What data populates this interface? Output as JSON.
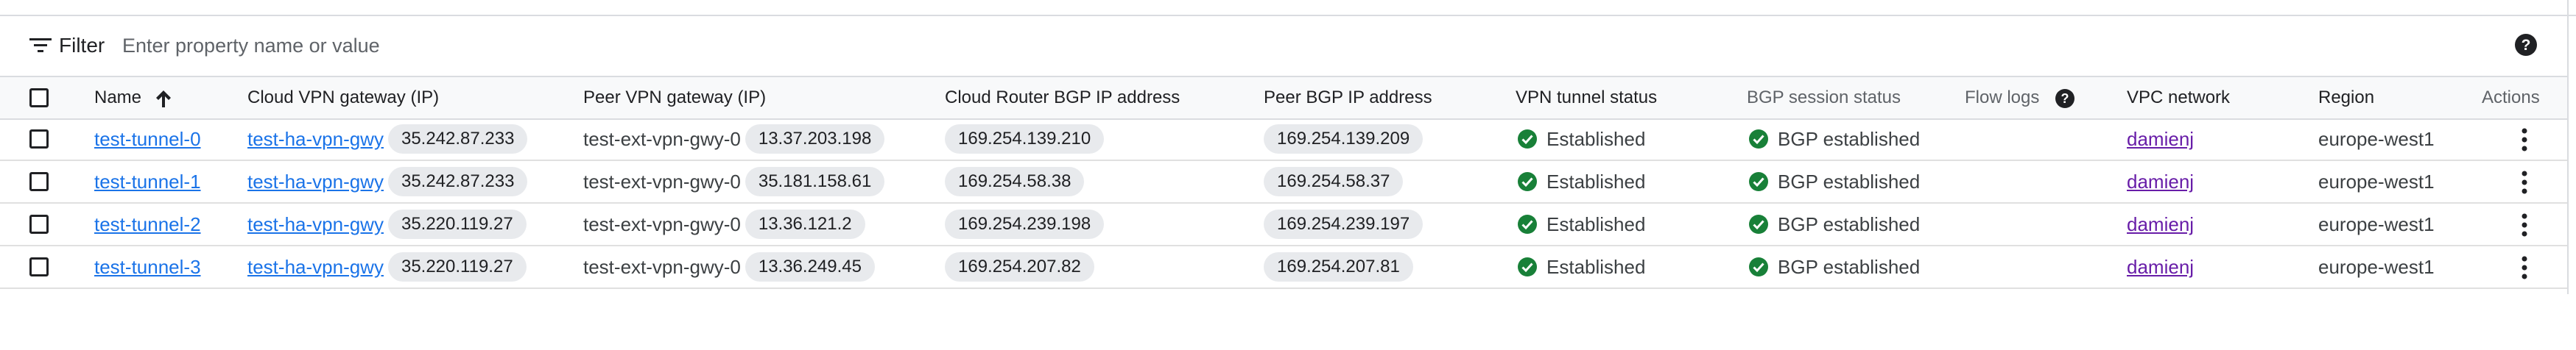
{
  "filter": {
    "label": "Filter",
    "placeholder": "Enter property name or value"
  },
  "columns": {
    "name": "Name",
    "cloud_vpn_gateway": "Cloud VPN gateway (IP)",
    "peer_vpn_gateway": "Peer VPN gateway (IP)",
    "cloud_router_bgp_ip": "Cloud Router BGP IP address",
    "peer_bgp_ip": "Peer BGP IP address",
    "vpn_tunnel_status": "VPN tunnel status",
    "bgp_session_status": "BGP session status",
    "flow_logs": "Flow logs",
    "vpc_network": "VPC network",
    "region": "Region",
    "actions": "Actions"
  },
  "sort": {
    "column": "Name",
    "direction": "ascending"
  },
  "icons": {
    "filter": "filter-icon",
    "help": "help-icon",
    "sort": "arrow-up-icon",
    "status": "check-circle-icon",
    "actions": "more-vert-icon"
  },
  "colors": {
    "link": "#1a73e8",
    "visited_link": "#681da8",
    "status_ok": "#188038",
    "chip_bg": "#e8eaed",
    "header_bg": "#f8f9fa"
  },
  "rows": [
    {
      "name": "test-tunnel-0",
      "cloud_gateway": "test-ha-vpn-gwy",
      "cloud_gateway_ip": "35.242.87.233",
      "peer_gateway": "test-ext-vpn-gwy-0",
      "peer_gateway_ip": "13.37.203.198",
      "cloud_router_bgp_ip": "169.254.139.210",
      "peer_bgp_ip": "169.254.139.209",
      "tunnel_status": "Established",
      "bgp_status": "BGP established",
      "vpc_network": "damienj",
      "region": "europe-west1"
    },
    {
      "name": "test-tunnel-1",
      "cloud_gateway": "test-ha-vpn-gwy",
      "cloud_gateway_ip": "35.242.87.233",
      "peer_gateway": "test-ext-vpn-gwy-0",
      "peer_gateway_ip": "35.181.158.61",
      "cloud_router_bgp_ip": "169.254.58.38",
      "peer_bgp_ip": "169.254.58.37",
      "tunnel_status": "Established",
      "bgp_status": "BGP established",
      "vpc_network": "damienj",
      "region": "europe-west1"
    },
    {
      "name": "test-tunnel-2",
      "cloud_gateway": "test-ha-vpn-gwy",
      "cloud_gateway_ip": "35.220.119.27",
      "peer_gateway": "test-ext-vpn-gwy-0",
      "peer_gateway_ip": "13.36.121.2",
      "cloud_router_bgp_ip": "169.254.239.198",
      "peer_bgp_ip": "169.254.239.197",
      "tunnel_status": "Established",
      "bgp_status": "BGP established",
      "vpc_network": "damienj",
      "region": "europe-west1"
    },
    {
      "name": "test-tunnel-3",
      "cloud_gateway": "test-ha-vpn-gwy",
      "cloud_gateway_ip": "35.220.119.27",
      "peer_gateway": "test-ext-vpn-gwy-0",
      "peer_gateway_ip": "13.36.249.45",
      "cloud_router_bgp_ip": "169.254.207.82",
      "peer_bgp_ip": "169.254.207.81",
      "tunnel_status": "Established",
      "bgp_status": "BGP established",
      "vpc_network": "damienj",
      "region": "europe-west1"
    }
  ]
}
